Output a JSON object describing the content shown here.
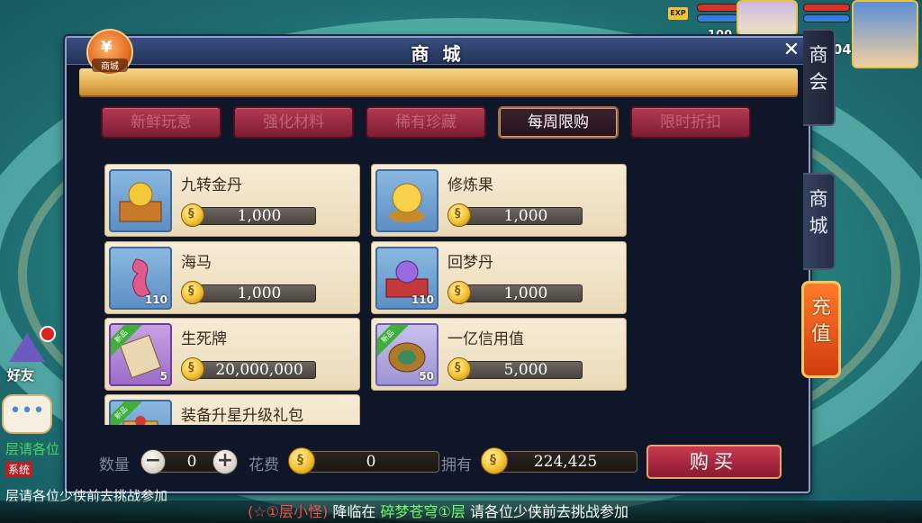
{
  "hud": {
    "exp_label": "EXP",
    "pet_level": "100",
    "player_level": "1104"
  },
  "panel": {
    "title": "商 城",
    "close_glyph": "✕",
    "shop_icon_glyph": "¥",
    "shop_icon_label": "商城"
  },
  "tabs": [
    {
      "label": "新鲜玩意",
      "active": false
    },
    {
      "label": "强化材料",
      "active": false
    },
    {
      "label": "稀有珍藏",
      "active": false
    },
    {
      "label": "每周限购",
      "active": true
    },
    {
      "label": "限时折扣",
      "active": false
    }
  ],
  "side_tabs": {
    "guild": "商会",
    "mall": "商城",
    "recharge": "充值"
  },
  "items": [
    {
      "name": "九转金丹",
      "price": "1,000",
      "count": "",
      "new": false,
      "icon": "golden-pill-chest-icon"
    },
    {
      "name": "修炼果",
      "price": "1,000",
      "count": "",
      "new": false,
      "icon": "golden-orb-icon"
    },
    {
      "name": "海马",
      "price": "1,000",
      "count": "110",
      "new": false,
      "icon": "seahorse-icon"
    },
    {
      "name": "回梦丹",
      "price": "1,000",
      "count": "110",
      "new": false,
      "icon": "crystal-orb-chest-icon"
    },
    {
      "name": "生死牌",
      "price": "20,000,000",
      "count": "5",
      "new": true,
      "new_label": "新品",
      "icon": "scroll-icon"
    },
    {
      "name": "一亿信用值",
      "price": "5,000",
      "count": "50",
      "new": true,
      "new_label": "新品",
      "icon": "coin-medallion-icon"
    },
    {
      "name": "装备升星升级礼包",
      "price": "",
      "count": "",
      "new": true,
      "new_label": "新品",
      "icon": "gift-pack-icon"
    }
  ],
  "bottom": {
    "quantity_label": "数量",
    "quantity_value": "0",
    "minus": "−",
    "plus": "+",
    "cost_label": "花费",
    "cost_value": "0",
    "owned_label": "拥有",
    "owned_value": "224,425",
    "buy_label": "购买"
  },
  "left_widgets": {
    "friend_label": "好友",
    "chat_glyph": "•••",
    "chat_line1": "层请各位",
    "system_tag": "系统",
    "chat_line3": "层请各位少侠前去挑战参加"
  },
  "marquee": {
    "part1": "(☆①层小怪)",
    "part2": "降临在",
    "part3": "碎梦苍穹①层",
    "part4": "请各位少侠前去挑战参加"
  },
  "colors": {
    "tab_inactive": "#9a2a42",
    "tab_active": "#2d1824",
    "panel_bg": "#0f1628",
    "item_card": "#f1e4c6",
    "recharge": "#e25a1e"
  }
}
